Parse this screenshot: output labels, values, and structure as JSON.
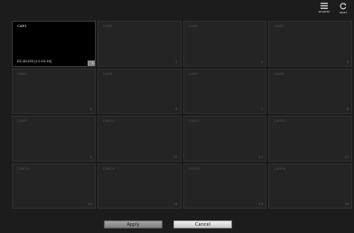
{
  "toolbar": {
    "segment_label": "SEGMENT",
    "reset_label": "RESET"
  },
  "cameras": [
    {
      "name": "CAM1",
      "num": "",
      "info": "DC-B1203 [11:24:16]",
      "badge": "1"
    },
    {
      "name": "CAM2",
      "num": "2"
    },
    {
      "name": "CAM3",
      "num": "3"
    },
    {
      "name": "CAM4",
      "num": "4"
    },
    {
      "name": "CAM5",
      "num": "5"
    },
    {
      "name": "CAM6",
      "num": "6"
    },
    {
      "name": "CAM7",
      "num": "7"
    },
    {
      "name": "CAM8",
      "num": "8"
    },
    {
      "name": "CAM9",
      "num": "9"
    },
    {
      "name": "CAM10",
      "num": "10"
    },
    {
      "name": "CAM11",
      "num": "11"
    },
    {
      "name": "CAM12",
      "num": "12"
    },
    {
      "name": "CAM13",
      "num": "13"
    },
    {
      "name": "CAM14",
      "num": "14"
    },
    {
      "name": "CAM15",
      "num": "15"
    },
    {
      "name": "CAM16",
      "num": "16"
    }
  ],
  "actions": {
    "apply_label": "Apply",
    "cancel_label": "Cancel"
  },
  "colors": {
    "background": "#1c1c1c",
    "cell": "#242424",
    "active_cell": "#000000"
  }
}
